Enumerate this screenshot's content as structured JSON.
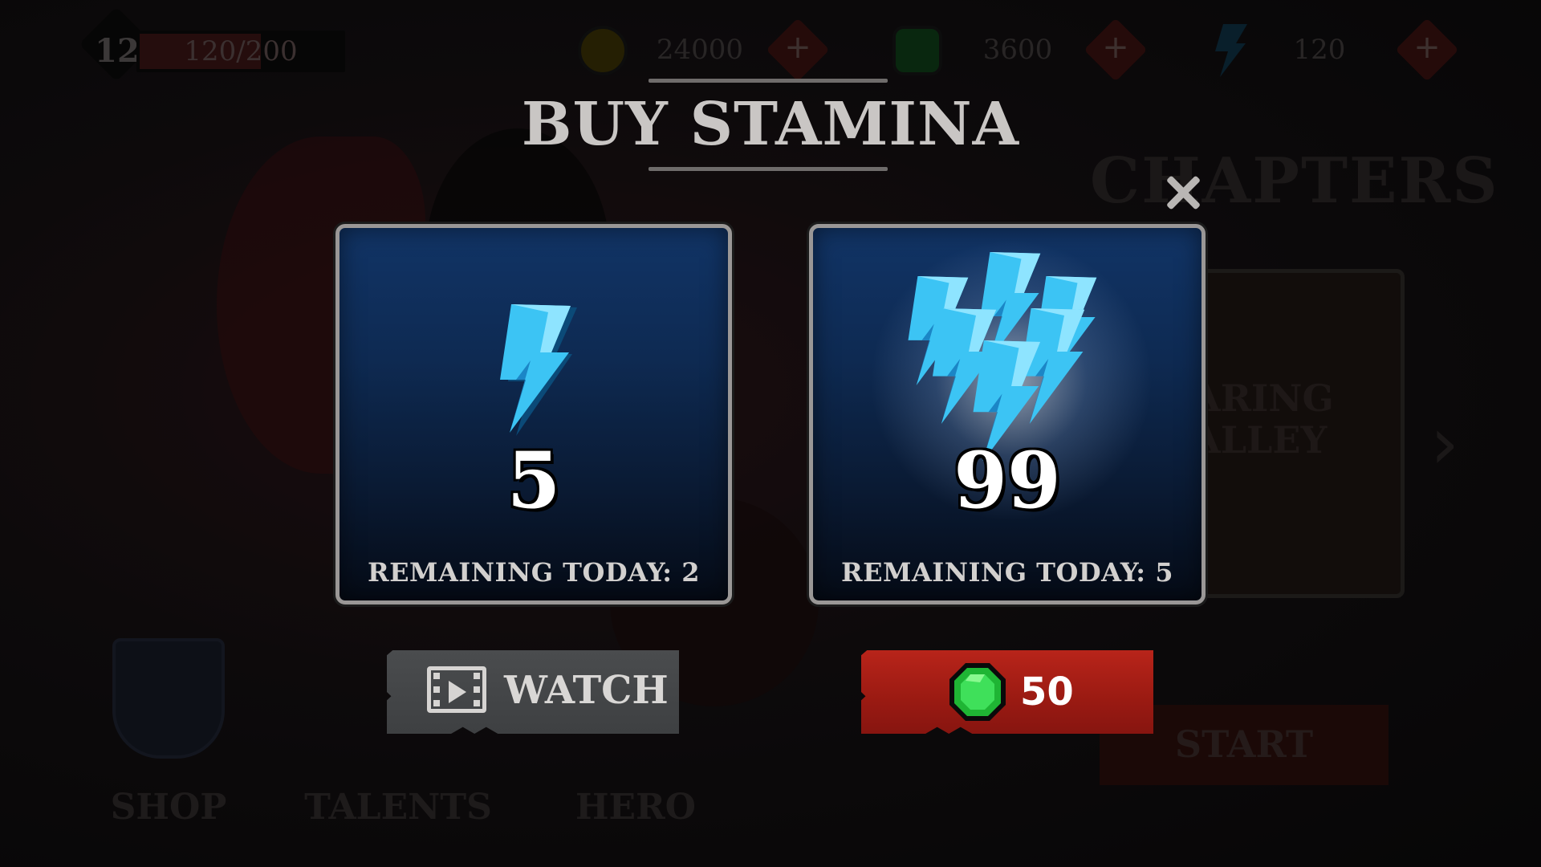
{
  "hud": {
    "level": "12",
    "xp_text": "120/200",
    "xp_progress": 0.6,
    "gold": "24000",
    "gems": "3600",
    "stamina": "120"
  },
  "background": {
    "chapters_title": "CHAPTERS",
    "chapter_card_text_line1": "ARING",
    "chapter_card_text_line2": "ALLEY",
    "start_label": "START",
    "nav": [
      "SHOP",
      "TALENTS",
      "HERO"
    ]
  },
  "modal": {
    "title": "BUY STAMINA",
    "offers": [
      {
        "amount": "5",
        "remaining": "REMAINING TODAY: 2",
        "button_label": "WATCH",
        "button_icon": "video-film-icon"
      },
      {
        "amount": "99",
        "remaining": "REMAINING TODAY: 5",
        "button_label": "50",
        "button_icon": "green-gem-icon"
      }
    ]
  },
  "colors": {
    "card_top": "#113466",
    "bolt": "#36b6f0",
    "buy_button": "#b8241a",
    "watch_button": "#4a4c4e",
    "gem": "#22c43a"
  }
}
